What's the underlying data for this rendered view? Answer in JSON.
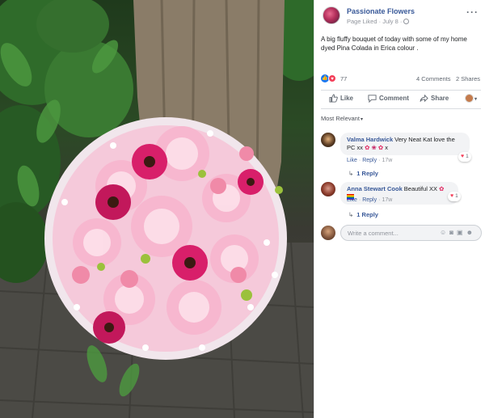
{
  "post": {
    "page_name": "Passionate Flowers",
    "meta_text": "Page Liked · July 8 ·",
    "text": "A big fluffy bouquet of today with some of my home dyed Pina Colada in Erica colour .",
    "reaction_count": "77",
    "comments_count": "4 Comments",
    "shares_count": "2 Shares"
  },
  "actions": {
    "like": "Like",
    "comment": "Comment",
    "share": "Share"
  },
  "sort_label": "Most Relevant",
  "comments": [
    {
      "author": "Valma Hardwick",
      "text": "Very Neat Kat love the PC xx",
      "text_tail": "x",
      "reaction_count": "1",
      "like": "Like",
      "reply": "Reply",
      "time": "17w",
      "replies": "1 Reply"
    },
    {
      "author": "Anna Stewart Cook",
      "text": "Beautiful XX",
      "reaction_count": "1",
      "like": "Like",
      "reply": "Reply",
      "time": "17w",
      "replies": "1 Reply"
    }
  ],
  "composer": {
    "placeholder": "Write a comment..."
  },
  "colors": {
    "link_blue": "#385898",
    "like_blue": "#1877f2",
    "love_red": "#f33e58"
  }
}
